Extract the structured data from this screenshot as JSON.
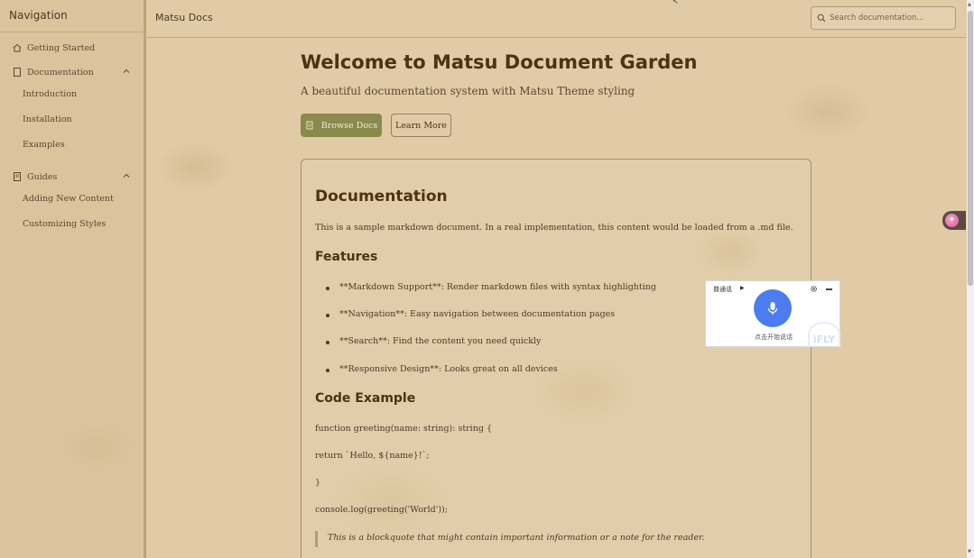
{
  "sidebar": {
    "title": "Navigation",
    "items": [
      {
        "label": "Getting Started",
        "icon": "home-icon"
      },
      {
        "label": "Documentation",
        "icon": "document-icon",
        "expanded": true,
        "children": [
          "Introduction",
          "Installation",
          "Examples"
        ]
      },
      {
        "label": "Guides",
        "icon": "book-icon",
        "expanded": true,
        "children": [
          "Adding New Content",
          "Customizing Styles"
        ]
      }
    ]
  },
  "header": {
    "title": "Matsu Docs",
    "search_placeholder": "Search documentation..."
  },
  "main": {
    "title": "Welcome to Matsu Document Garden",
    "subtitle": "A beautiful documentation system with Matsu Theme styling",
    "primary_button": "Browse Docs",
    "secondary_button": "Learn More",
    "doc": {
      "heading": "Documentation",
      "intro": "This is a sample markdown document. In a real implementation, this content would be loaded from a .md file.",
      "features_heading": "Features",
      "features": [
        "**Markdown Support**: Render markdown files with syntax highlighting",
        "**Navigation**: Easy navigation between documentation pages",
        "**Search**: Find the content you need quickly",
        "**Responsive Design**: Looks great on all devices"
      ],
      "code_heading": "Code Example",
      "code_lines": [
        "function greeting(name: string): string {",
        "return `Hello, ${name}!`;",
        "}",
        "console.log(greeting('World'));"
      ],
      "blockquote": "This is a blockquote that might contain important information or a note for the reader."
    }
  },
  "voice_widget": {
    "language": "普通话",
    "hint": "点击开始说话",
    "logo": "iFLY",
    "accent": "#4c7df0"
  },
  "colors": {
    "background": "#e0cba6",
    "heading": "#4e3213",
    "primary_button": "#8a8a4c",
    "border": "#a88d6b"
  }
}
